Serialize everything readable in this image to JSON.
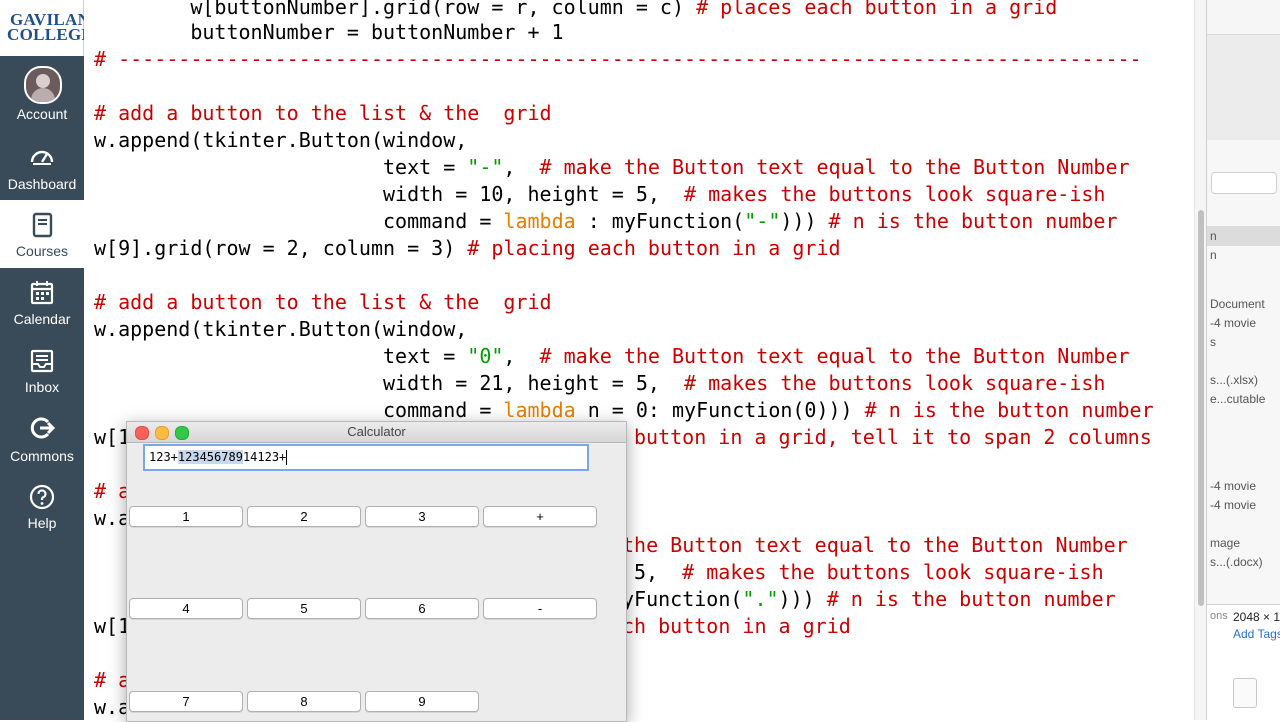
{
  "sidebar": {
    "logo_line1": "GAVILAN",
    "logo_line2": "COLLEGE",
    "items": [
      {
        "label": "Account",
        "icon": "avatar"
      },
      {
        "label": "Dashboard",
        "icon": "dashboard-icon"
      },
      {
        "label": "Courses",
        "icon": "book-icon",
        "active": true
      },
      {
        "label": "Calendar",
        "icon": "calendar-icon"
      },
      {
        "label": "Inbox",
        "icon": "inbox-icon"
      },
      {
        "label": "Commons",
        "icon": "commons-icon"
      },
      {
        "label": "Help",
        "icon": "help-icon"
      }
    ]
  },
  "code": {
    "l1_code": "        w[buttonNumber].grid(row = r, column = c) ",
    "l1_comment": "# places each button in a grid",
    "l2_code": "        buttonNumber = buttonNumber + 1",
    "l3_comment": "# -------------------------------------------------------------------------------------",
    "l4_comment": "# add a button to the list & the  grid",
    "l5_code": "w.append(tkinter.Button(window,",
    "l6_pre": "                        text = ",
    "l6_str": "\"-\"",
    "l6_mid": ",  ",
    "l6_comment": "# make the Button text equal to the Button Number",
    "l7_code": "                        width = 10, height = 5,  ",
    "l7_comment": "# makes the buttons look square-ish",
    "l8_pre": "                        command = ",
    "l8_kw": "lambda",
    "l8_mid": " : myFunction(",
    "l8_str": "\"-\"",
    "l8_post": "))) ",
    "l8_comment": "# n is the button number",
    "l9_code": "w[9].grid(row = 2, column = 3) ",
    "l9_comment": "# placing each button in a grid",
    "l10_comment": "# add a button to the list & the  grid",
    "l11_code": "w.append(tkinter.Button(window,",
    "l12_pre": "                        text = ",
    "l12_str": "\"0\"",
    "l12_mid": ",  ",
    "l12_comment": "# make the Button text equal to the Button Number",
    "l13_code": "                        width = 21, height = 5,  ",
    "l13_comment": "# makes the buttons look square-ish",
    "l14_pre": "                        command = ",
    "l14_kw": "lambda",
    "l14_mid": " n = 0: myFunction(0))) ",
    "l14_comment": "# n is the button number",
    "l15_code": "w[1",
    "l15_tail": "button in a grid, tell it to span 2 columns",
    "l16_code": "# a",
    "l17_code": "w.a",
    "l18_tail": "the Button text equal to the Button Number",
    "l19_tail_code": "5,  ",
    "l19_tail_comment": "# makes the buttons look square-ish",
    "l20_tail_code": "yFunction(",
    "l20_tail_str": "\".\"",
    "l20_tail_post": "))) ",
    "l20_tail_comment": "# n is the button number",
    "l21_code": "w[1",
    "l21_tail": "ch button in a grid",
    "l22_code": "# a",
    "l23_code": "w.a"
  },
  "finder": {
    "items": [
      "n",
      "n",
      "Document",
      "-4 movie",
      "s",
      "s...(.xlsx)",
      "e...cutable",
      "-4 movie",
      "-4 movie",
      "mage",
      "s...(.docx)",
      "ons",
      "2048 × 1",
      "Add Tags"
    ]
  },
  "calculator": {
    "title": "Calculator",
    "display_pre": "123+",
    "display_sel": "123456789",
    "display_post": "14123+",
    "buttons": [
      "1",
      "2",
      "3",
      "+",
      "4",
      "5",
      "6",
      "-",
      "7",
      "8",
      "9"
    ]
  },
  "colors": {
    "sidebar_bg": "#394b58",
    "comment": "#cc0000",
    "string": "#00a000",
    "keyword": "#e87e00",
    "logo": "#1f4f8f"
  }
}
